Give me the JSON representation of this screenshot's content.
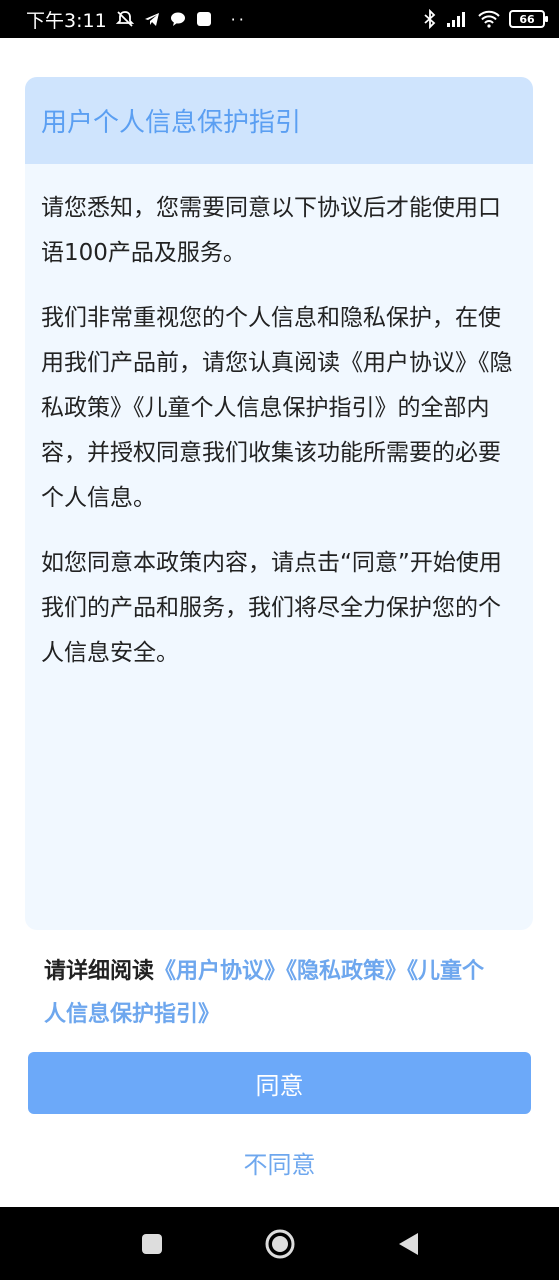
{
  "status_bar": {
    "time": "下午3:11",
    "icons": [
      "mute-bell-icon",
      "telegram-icon",
      "chat-bubble-icon",
      "square-notification-icon",
      "bluetooth-icon",
      "signal-icon",
      "wifi-icon"
    ],
    "dots": "··",
    "battery": "66"
  },
  "dialog": {
    "title": "用户个人信息保护指引",
    "paragraphs": [
      "请您悉知，您需要同意以下协议后才能使用口语100产品及服务。",
      "我们非常重视您的个人信息和隐私保护，在使用我们产品前，请您认真阅读《用户协议》《隐私政策》《儿童个人信息保护指引》的全部内容，并授权同意我们收集该功能所需要的必要个人信息。",
      "如您同意本政策内容，请点击“同意”开始使用我们的产品和服务，我们将尽全力保护您的个人信息安全。"
    ]
  },
  "read_notice": {
    "prefix": "请详细阅读",
    "links": [
      "《用户协议》",
      "《隐私政策》",
      "《儿童个人信息保护指引》"
    ]
  },
  "buttons": {
    "agree": "同意",
    "disagree": "不同意"
  },
  "nav_bar": {
    "icons": [
      "recents-square-icon",
      "home-circle-icon",
      "back-triangle-icon"
    ]
  },
  "colors": {
    "accent": "#6ca9f9",
    "link": "#6ea7ee",
    "header_bg": "#cfe4fd",
    "card_bg": "#f1f8ff"
  }
}
